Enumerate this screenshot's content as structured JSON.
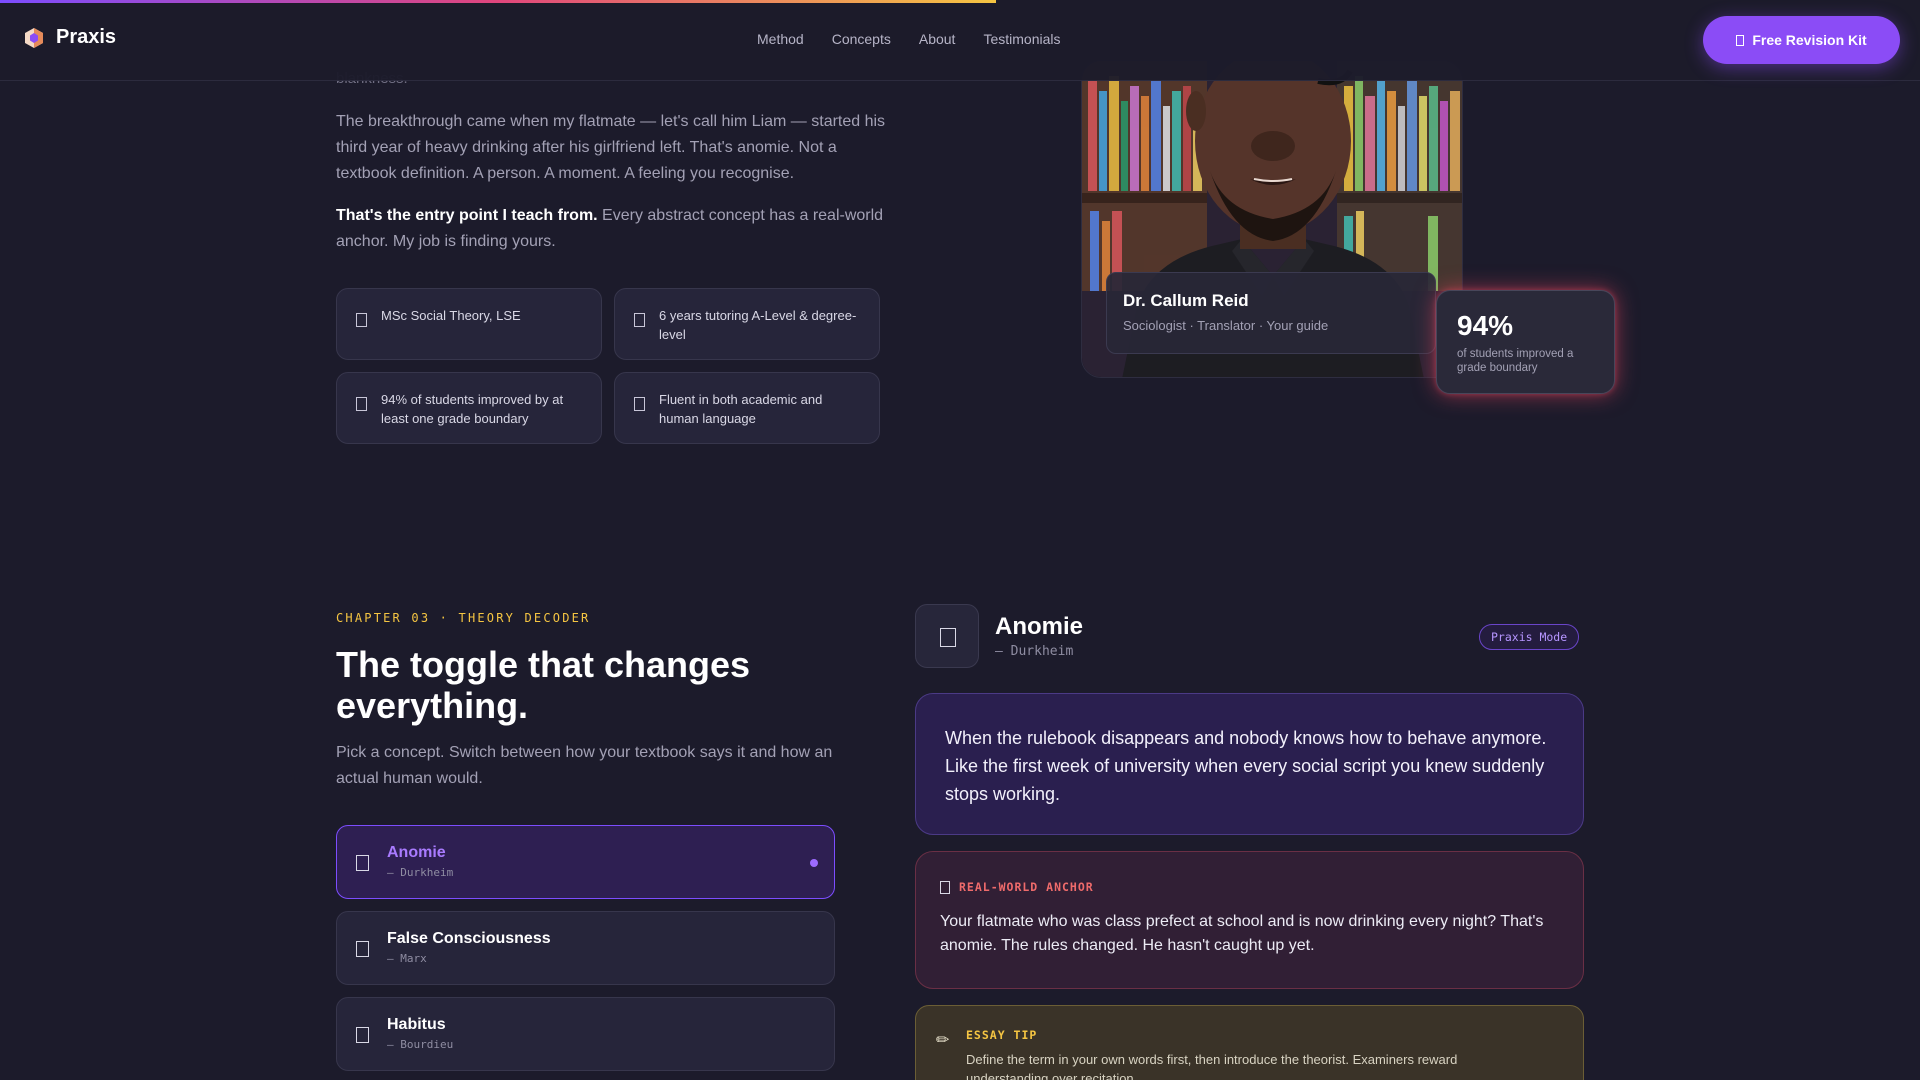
{
  "progress": {
    "fraction": 0.519
  },
  "header": {
    "brand": "Praxis",
    "nav": [
      "Method",
      "Concepts",
      "About",
      "Testimonials"
    ],
    "cta_label": "Free Revision Kit"
  },
  "about": {
    "clipped_text": "blankness.",
    "para1": "The breakthrough came when my flatmate — let's call him Liam — started his third year of heavy drinking after his girlfriend left. That's anomie. Not a textbook definition. A person. A moment. A feeling you recognise.",
    "para2_strong": "That's the entry point I teach from.",
    "para2_rest": " Every abstract concept has a real-world anchor. My job is finding yours.",
    "credentials": [
      "MSc Social Theory, LSE",
      "6 years tutoring A-Level & degree-level",
      "94% of students improved by at least one grade boundary",
      "Fluent in both academic and human language"
    ],
    "profile": {
      "name": "Dr. Callum Reid",
      "role": "Sociologist · Translator · Your guide"
    },
    "stat": {
      "value": "94%",
      "label": "of students improved a grade boundary"
    }
  },
  "decoder": {
    "eyebrow": "CHAPTER 03 · THEORY DECODER",
    "heading": "The toggle that changes everything.",
    "subheading": "Pick a concept. Switch between how your textbook says it and how an actual human would.",
    "concepts": [
      {
        "title": "Anomie",
        "author": "— Durkheim",
        "active": true
      },
      {
        "title": "False Consciousness",
        "author": "— Marx",
        "active": false
      },
      {
        "title": "Habitus",
        "author": "— Bourdieu",
        "active": false
      }
    ],
    "detail": {
      "title": "Anomie",
      "author": "— Durkheim",
      "mode": "Praxis Mode",
      "quote": "When the rulebook disappears and nobody knows how to behave anymore. Like the first week of university when every social script you knew suddenly stops working.",
      "anchor_label": "REAL-WORLD ANCHOR",
      "anchor_text": "Your flatmate who was class prefect at school and is now drinking every night? That's anomie. The rules changed. He hasn't caught up yet.",
      "tip_label": "ESSAY TIP",
      "tip_text": "Define the term in your own words first, then introduce the theorist. Examiners reward understanding over recitation."
    }
  },
  "colors": {
    "background": "#1c1b2b",
    "accent": "#8b4cf6",
    "eyebrow": "#f5c542",
    "anchor": "#ef6b6b"
  }
}
